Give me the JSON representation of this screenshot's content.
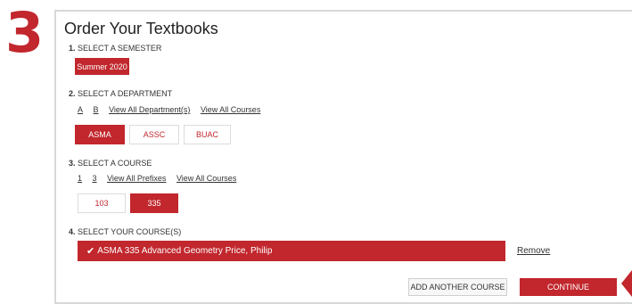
{
  "step": {
    "number": "3"
  },
  "page_title": "Order Your Textbooks",
  "semester": {
    "label_num": "1.",
    "label": "SELECT A SEMESTER",
    "options": [
      {
        "label": "Summer 2020",
        "selected": true
      }
    ]
  },
  "department": {
    "label_num": "2.",
    "label": "SELECT A DEPARTMENT",
    "links": [
      "A",
      "B",
      "View All Department(s)",
      "View All Courses"
    ],
    "options": [
      {
        "label": "ASMA",
        "selected": true
      },
      {
        "label": "ASSC",
        "selected": false
      },
      {
        "label": "BUAC",
        "selected": false
      }
    ]
  },
  "course": {
    "label_num": "3.",
    "label": "SELECT A COURSE",
    "links": [
      "1",
      "3",
      "View All Prefixes",
      "View All Courses"
    ],
    "options": [
      {
        "label": "103",
        "selected": false
      },
      {
        "label": "335",
        "selected": true
      }
    ]
  },
  "your_courses": {
    "label_num": "4.",
    "label": "SELECT YOUR COURSE(S)",
    "selected_course": "ASMA 335  Advanced Geometry Price, Philip",
    "remove_label": "Remove"
  },
  "actions": {
    "add_another": "ADD ANOTHER COURSE",
    "continue": "CONTINUE"
  },
  "colors": {
    "accent": "#c1272d",
    "border": "#d8d8d8"
  }
}
